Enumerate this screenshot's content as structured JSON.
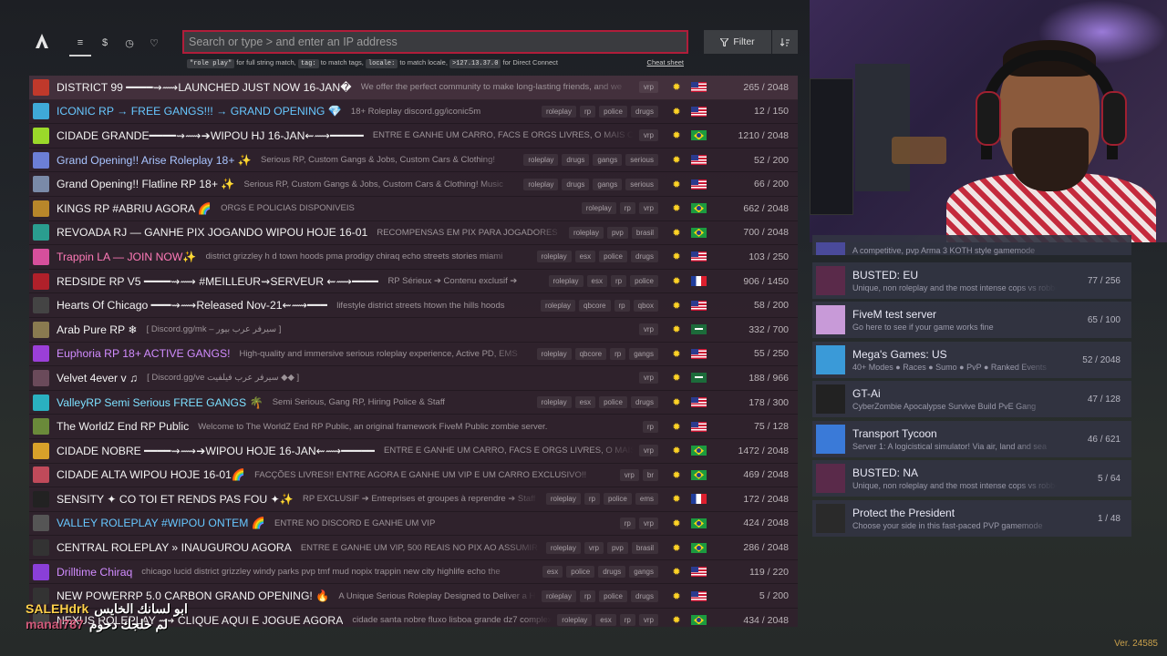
{
  "toolbar": {
    "search_placeholder": "Search or type > and enter an IP address",
    "hint_parts": [
      "\"role play\"",
      " for full string match, ",
      "tag:",
      " to match tags, ",
      "locale:",
      " to match locale, ",
      ">127.13.37.0",
      " for Direct Connect"
    ],
    "cheat_sheet": "Cheat sheet",
    "filter_label": "Filter",
    "nav": [
      "≡",
      "$",
      "◷",
      "♡"
    ]
  },
  "servers": [
    {
      "name": "DISTRICT 99 ━━━━⇝⟿LAUNCHED JUST NOW 16-JAN�",
      "desc": "We offer the perfect community to make long-lasting friends, and we",
      "tags": [
        "vrp"
      ],
      "flag": "us",
      "players": "265 / 2048",
      "icon": "#c0392b"
    },
    {
      "name": "ICONIC RP → FREE GANGS!!! → GRAND OPENING 💎",
      "desc": "18+ Roleplay discord.gg/iconic5m",
      "tags": [
        "roleplay",
        "rp",
        "police",
        "drugs"
      ],
      "flag": "us",
      "players": "12 / 150",
      "icon": "#3fa9d8",
      "color": "#67c7ff"
    },
    {
      "name": "CIDADE GRANDE━━━━⇝⟿➔WIPOU HJ 16-JAN⇜⟿━━━━━",
      "desc": "ENTRE E GANHE UM CARRO, FACS E ORGS LIVRES, O MAIS OTIMIZADO",
      "tags": [
        "vrp"
      ],
      "flag": "br",
      "players": "1210 / 2048",
      "icon": "#9bd82a"
    },
    {
      "name": "Grand Opening!! Arise Roleplay 18+ ✨",
      "desc": "Serious RP, Custom Gangs & Jobs, Custom Cars & Clothing!",
      "tags": [
        "roleplay",
        "drugs",
        "gangs",
        "serious"
      ],
      "flag": "us",
      "players": "52 / 200",
      "icon": "#6c7fd6",
      "color": "#a8c4ff"
    },
    {
      "name": "Grand Opening!! Flatline RP 18+ ✨",
      "desc": "Serious RP, Custom Gangs & Jobs, Custom Cars & Clothing! Music",
      "tags": [
        "roleplay",
        "drugs",
        "gangs",
        "serious"
      ],
      "flag": "us",
      "players": "66 / 200",
      "icon": "#7a8aa8"
    },
    {
      "name": "KINGS RP #ABRIU AGORA 🌈",
      "desc": "ORGS E POLICIAS DISPONIVEIS",
      "tags": [
        "roleplay",
        "rp",
        "vrp"
      ],
      "flag": "br",
      "players": "662 / 2048",
      "icon": "#b8862a"
    },
    {
      "name": "REVOADA RJ — GANHE PIX JOGANDO WIPOU HOJE 16-01",
      "desc": "RECOMPENSAS EM PIX PARA JOGADORES",
      "tags": [
        "roleplay",
        "pvp",
        "brasil"
      ],
      "flag": "br",
      "players": "700 / 2048",
      "icon": "#2a9d8f"
    },
    {
      "name": "Trappin LA — JOIN NOW✨",
      "desc": "district grizzley h d town hoods pma prodigy chiraq echo streets stories miami",
      "tags": [
        "roleplay",
        "esx",
        "police",
        "drugs"
      ],
      "flag": "us",
      "players": "103 / 250",
      "icon": "#d64f9c",
      "color": "#ff7ab8"
    },
    {
      "name": "REDSIDE RP V5 ━━━━⇝⟿ #MEILLEUR⇝SERVEUR ⇜⟿━━━━",
      "desc": "RP Sérieux ➔ Contenu exclusif ➔",
      "tags": [
        "roleplay",
        "esx",
        "rp",
        "police"
      ],
      "flag": "fr",
      "players": "906 / 1450",
      "icon": "#b0202a"
    },
    {
      "name": "Hearts Of Chicago ━━━⇝⟿Released Nov-21⇜⟿━━━",
      "desc": "lifestyle district streets htown the hills hoods",
      "tags": [
        "roleplay",
        "qbcore",
        "rp",
        "qbox"
      ],
      "flag": "us",
      "players": "58 / 200",
      "icon": "#444"
    },
    {
      "name": "Arab Pure RP ❄",
      "desc": "[ Discord.gg/mk – سيرفر عرب بيور ]",
      "tags": [
        "vrp"
      ],
      "flag": "sa",
      "players": "332 / 700",
      "icon": "#8a7a50"
    },
    {
      "name": "Euphoria RP 18+ ACTIVE GANGS!",
      "desc": "High-quality and immersive serious roleplay experience, Active PD, EMS",
      "tags": [
        "roleplay",
        "qbcore",
        "rp",
        "gangs"
      ],
      "flag": "us",
      "players": "55 / 250",
      "icon": "#9b3fd8",
      "color": "#d18cff"
    },
    {
      "name": "Velvet 4ever v ♫",
      "desc": "[ Discord.gg/ve سيرفر عرب فيلفيت ◆◆ ]",
      "tags": [
        "vrp"
      ],
      "flag": "sa",
      "players": "188 / 966",
      "icon": "#6a4a5a"
    },
    {
      "name": "ValleyRP Semi Serious FREE GANGS 🌴",
      "desc": "Semi Serious, Gang RP, Hiring Police & Staff",
      "tags": [
        "roleplay",
        "esx",
        "police",
        "drugs"
      ],
      "flag": "us",
      "players": "178 / 300",
      "icon": "#2ab0c0",
      "color": "#7de0ff"
    },
    {
      "name": "The WorldZ End RP Public",
      "desc": "Welcome to The WorldZ End RP Public, an original framework FiveM Public zombie server.",
      "tags": [
        "rp"
      ],
      "flag": "us",
      "players": "75 / 128",
      "icon": "#6a8a3a"
    },
    {
      "name": "CIDADE NOBRE ━━━━⇝⟿➔WIPOU HOJE 16-JAN⇜⟿━━━━━",
      "desc": "ENTRE E GANHE UM CARRO, FACS E ORGS LIVRES, O MAIS OTIMIZADO",
      "tags": [
        "vrp"
      ],
      "flag": "br",
      "players": "1472 / 2048",
      "icon": "#d8a12a"
    },
    {
      "name": "CIDADE ALTA WIPOU HOJE 16-01🌈",
      "desc": "FACÇÕES LIVRES!! ENTRE AGORA E GANHE UM VIP E UM CARRO EXCLUSIVO!!",
      "tags": [
        "vrp",
        "br"
      ],
      "flag": "br",
      "players": "469 / 2048",
      "icon": "#c04a5a"
    },
    {
      "name": "SENSITY ✦ CO TOI ET RENDS PAS FOU ✦✨",
      "desc": "RP EXCLUSIF ➔ Entreprises et groupes à reprendre ➔ Staff",
      "tags": [
        "roleplay",
        "rp",
        "police",
        "ems"
      ],
      "flag": "fr",
      "players": "172 / 2048",
      "icon": "#222"
    },
    {
      "name": "VALLEY ROLEPLAY #WIPOU ONTEM 🌈",
      "desc": "ENTRE NO DISCORD E GANHE UM VIP",
      "tags": [
        "rp",
        "vrp"
      ],
      "flag": "br",
      "players": "424 / 2048",
      "icon": "#555",
      "color": "#67c7ff"
    },
    {
      "name": "CENTRAL ROLEPLAY » INAUGUROU AGORA",
      "desc": "ENTRE E GANHE UM VIP, 500 REAIS NO PIX AO ASSUMIR UMA",
      "tags": [
        "roleplay",
        "vrp",
        "pvp",
        "brasil"
      ],
      "flag": "br",
      "players": "286 / 2048",
      "icon": "#333"
    },
    {
      "name": "Drilltime Chiraq",
      "desc": "chicago lucid district grizzley windy parks pvp tmf mud nopix trappin new city highlife echo the",
      "tags": [
        "esx",
        "police",
        "drugs",
        "gangs"
      ],
      "flag": "us",
      "players": "119 / 220",
      "icon": "#8a3fd8",
      "color": "#d18cff"
    },
    {
      "name": "NEW POWERRP 5.0 CARBON GRAND OPENING! 🔥",
      "desc": "A Unique Serious Roleplay Designed to Deliver a High",
      "tags": [
        "roleplay",
        "rp",
        "police",
        "drugs"
      ],
      "flag": "us",
      "players": "5 / 200",
      "icon": "#333"
    },
    {
      "name": "NEXUS ROLEPLAY ⟿ CLIQUE AQUI E JOGUE AGORA",
      "desc": "cidade santa nobre fluxo lisboa grande dz7 complexo",
      "tags": [
        "roleplay",
        "esx",
        "rp",
        "vrp"
      ],
      "flag": "br",
      "players": "434 / 2048",
      "icon": "#444"
    }
  ],
  "side_servers": [
    {
      "name": "",
      "desc": "A competitive, pvp Arma 3 KOTH style gamemode",
      "players": "",
      "thumb": "#4a4a9a"
    },
    {
      "name": "BUSTED: EU",
      "desc": "Unique, non roleplay and the most intense cops vs robbers",
      "players": "77 / 256",
      "thumb": "#5a2a4a"
    },
    {
      "name": "FiveM test server",
      "desc": "Go here to see if your game works fine",
      "players": "65 / 100",
      "thumb": "#c89ad8"
    },
    {
      "name": "Mega's Games: US",
      "desc": "40+ Modes ● Races ● Sumo ● PvP ● Ranked Events",
      "players": "52 / 2048",
      "thumb": "#3a9ad8"
    },
    {
      "name": "GT-Ai",
      "desc": "CyberZombie Apocalypse Survive Build PvE Gang",
      "players": "47 / 128",
      "thumb": "#222"
    },
    {
      "name": "Transport Tycoon",
      "desc": "Server 1: A logicistical simulator! Via air, land and sea",
      "players": "46 / 621",
      "thumb": "#3a7ad8"
    },
    {
      "name": "BUSTED: NA",
      "desc": "Unique, non roleplay and the most intense cops vs robbers",
      "players": "5 / 64",
      "thumb": "#5a2a4a"
    },
    {
      "name": "Protect the President",
      "desc": "Choose your side in this fast-paced PVP gamemode",
      "players": "1 / 48",
      "thumb": "#2a2a2a"
    }
  ],
  "chat": {
    "user1": "SALEHdrk",
    "msg1": "ابو لسانك الخايس",
    "user2": "manal787",
    "msg2": "لم حلجك دحوم"
  },
  "version": "Ver. 24585",
  "colors": {
    "accent": "#b01d3a",
    "list_bg": "#30222c",
    "sun": "#ffd426"
  }
}
